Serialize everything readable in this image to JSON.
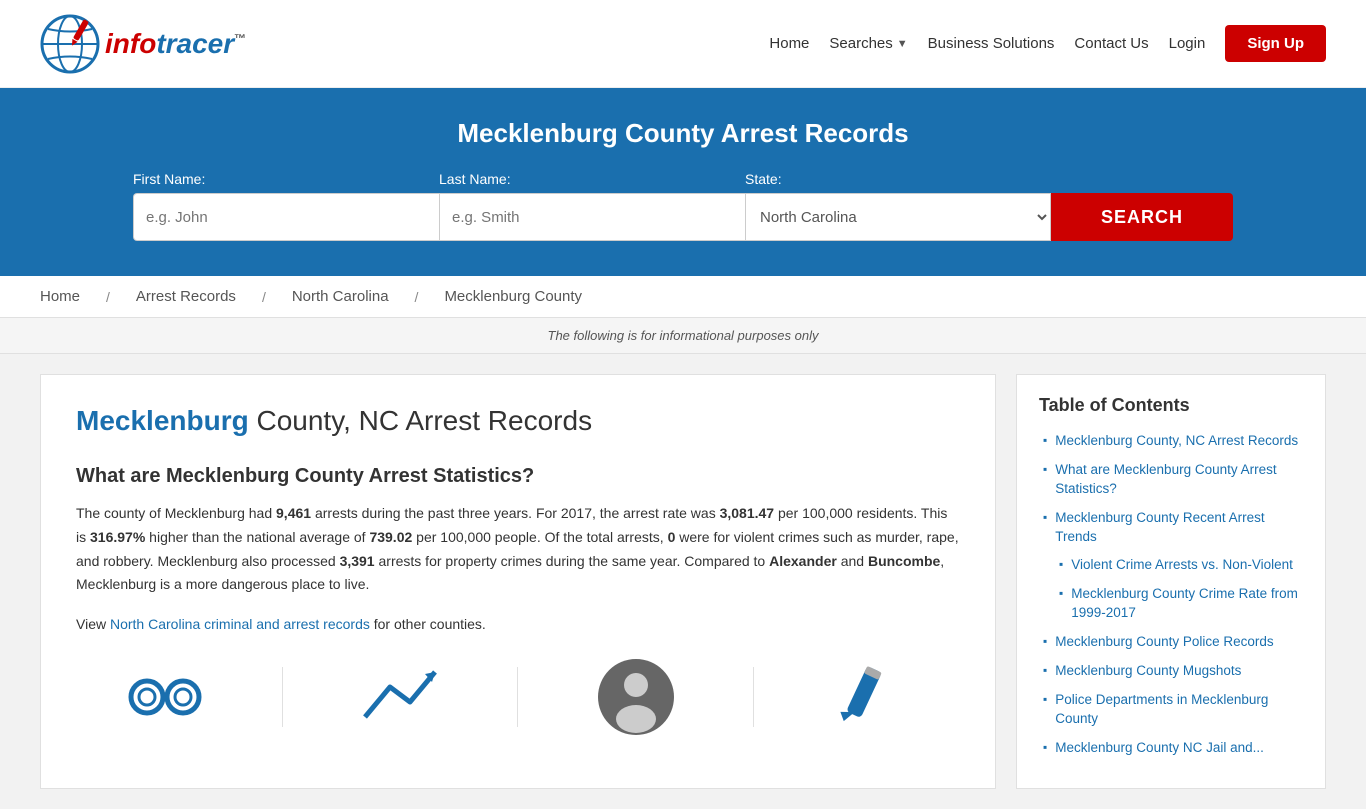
{
  "header": {
    "logo": {
      "info": "info",
      "tracer": "tracer",
      "tm": "™"
    },
    "nav": {
      "home": "Home",
      "searches": "Searches",
      "business_solutions": "Business Solutions",
      "contact_us": "Contact Us",
      "login": "Login",
      "signup": "Sign Up"
    }
  },
  "hero": {
    "title": "Mecklenburg County Arrest Records",
    "first_name_label": "First Name:",
    "first_name_placeholder": "e.g. John",
    "last_name_label": "Last Name:",
    "last_name_placeholder": "e.g. Smith",
    "state_label": "State:",
    "state_value": "North Carolina",
    "search_button": "SEARCH"
  },
  "breadcrumb": {
    "home": "Home",
    "arrest_records": "Arrest Records",
    "north_carolina": "North Carolina",
    "mecklenburg_county": "Mecklenburg County"
  },
  "info_bar": {
    "text": "The following is for informational purposes only"
  },
  "article": {
    "title_highlight": "Mecklenburg",
    "title_rest": " County, NC Arrest Records",
    "section1_heading": "What are Mecklenburg County Arrest Statistics?",
    "paragraph1": "The county of Mecklenburg had 9,461 arrests during the past three years. For 2017, the arrest rate was 3,081.47 per 100,000 residents. This is 316.97% higher than the national average of 739.02 per 100,000 people. Of the total arrests, 0 were for violent crimes such as murder, rape, and robbery. Mecklenburg also processed 3,391 arrests for property crimes during the same year. Compared to Alexander and Buncombe, Mecklenburg is a more dangerous place to live.",
    "view_records_prefix": "View ",
    "view_records_link": "North Carolina criminal and arrest records",
    "view_records_suffix": " for other counties.",
    "stat_arrests": "9,461",
    "stat_rate": "3,081.47",
    "stat_percent": "316.97%",
    "stat_national": "739.02",
    "stat_violent": "0",
    "stat_property": "3,391",
    "compare1": "Alexander",
    "compare2": "Buncombe"
  },
  "toc": {
    "title": "Table of Contents",
    "items": [
      {
        "label": "Mecklenburg County, NC Arrest Records",
        "sub": false
      },
      {
        "label": "What are Mecklenburg County Arrest Statistics?",
        "sub": false
      },
      {
        "label": "Mecklenburg County Recent Arrest Trends",
        "sub": false
      },
      {
        "label": "Violent Crime Arrests vs. Non-Violent",
        "sub": true
      },
      {
        "label": "Mecklenburg County Crime Rate from 1999-2017",
        "sub": true
      },
      {
        "label": "Mecklenburg County Police Records",
        "sub": false
      },
      {
        "label": "Mecklenburg County Mugshots",
        "sub": false
      },
      {
        "label": "Police Departments in Mecklenburg County",
        "sub": false
      },
      {
        "label": "Mecklenburg County NC Jail and...",
        "sub": false
      }
    ]
  }
}
